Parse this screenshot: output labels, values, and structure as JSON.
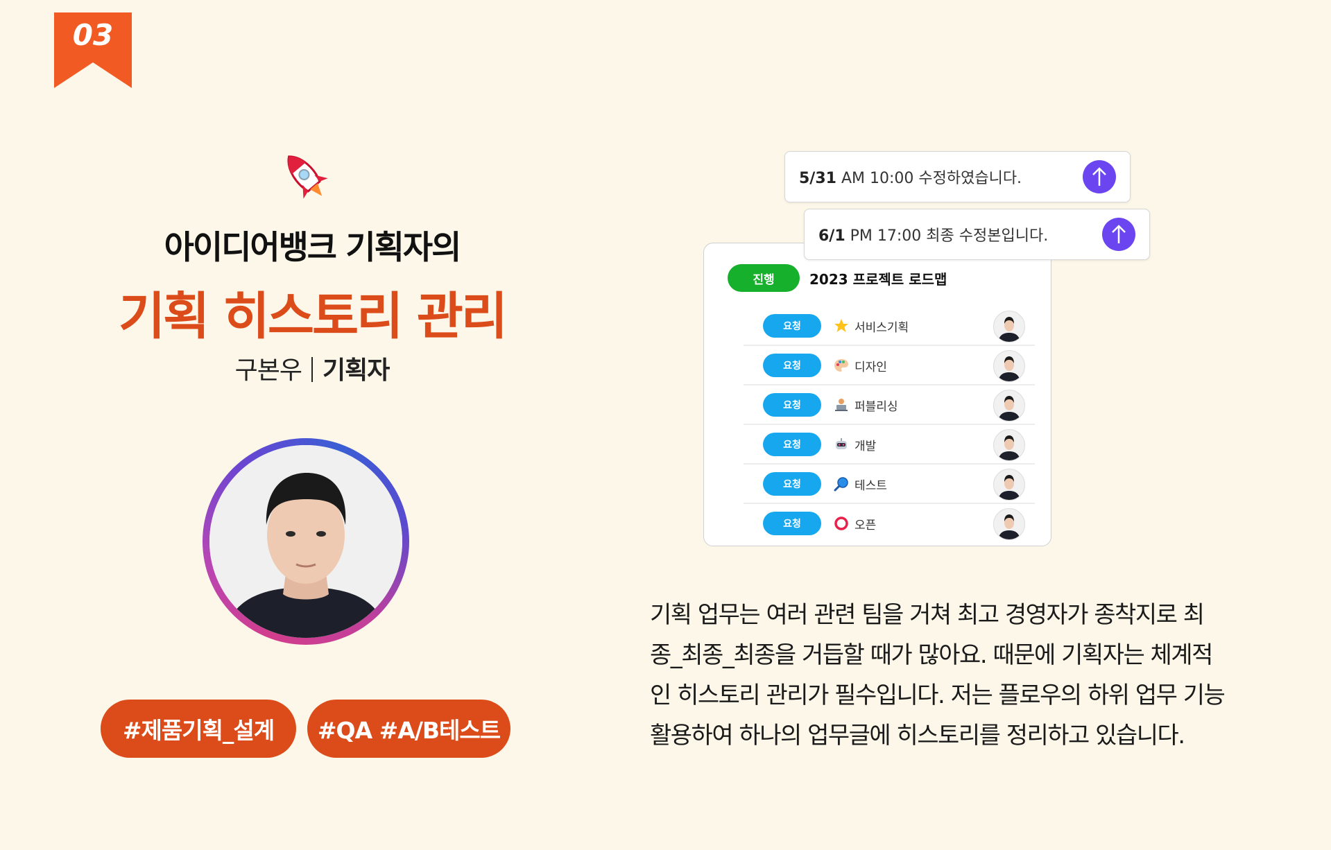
{
  "badge": {
    "number": "03",
    "color": "#f15a22"
  },
  "headline": "아이디어뱅크 기획자의",
  "title": "기획 히스토리 관리",
  "byline": {
    "name": "구본우",
    "role": "기획자"
  },
  "tags": [
    "#제품기획_설계",
    "#QA #A/B테스트"
  ],
  "notes": [
    {
      "date": "5/31",
      "text": " AM 10:00 수정하였습니다."
    },
    {
      "date": "6/1",
      "text": " PM 17:00 최종 수정본입니다."
    }
  ],
  "card": {
    "status": "진행",
    "title": "2023 프로젝트 로드맵",
    "rows": [
      {
        "status": "요청",
        "icon": "star-icon",
        "label": "서비스기획"
      },
      {
        "status": "요청",
        "icon": "palette-icon",
        "label": "디자인"
      },
      {
        "status": "요청",
        "icon": "laptop-icon",
        "label": "퍼블리싱"
      },
      {
        "status": "요청",
        "icon": "robot-icon",
        "label": "개발"
      },
      {
        "status": "요청",
        "icon": "magnifier-icon",
        "label": "테스트"
      },
      {
        "status": "요청",
        "icon": "circle-icon",
        "label": "오픈"
      }
    ]
  },
  "description": [
    "기획 업무는 여러 관련 팀을 거쳐 최고 경영자가 종착지로  최",
    "종_최종_최종을 거듭할 때가 많아요. 때문에 기획자는 체계적",
    "인 히스토리 관리가 필수입니다. 저는 플로우의 하위 업무 기능",
    "활용하여 하나의 업무글에 히스토리를 정리하고 있습니다."
  ],
  "colors": {
    "background": "#fcf7e8",
    "accent": "#dc4b1a",
    "status_progress": "#17b02c",
    "status_request": "#16a7ee",
    "arrow_button": "#6b45f0"
  }
}
